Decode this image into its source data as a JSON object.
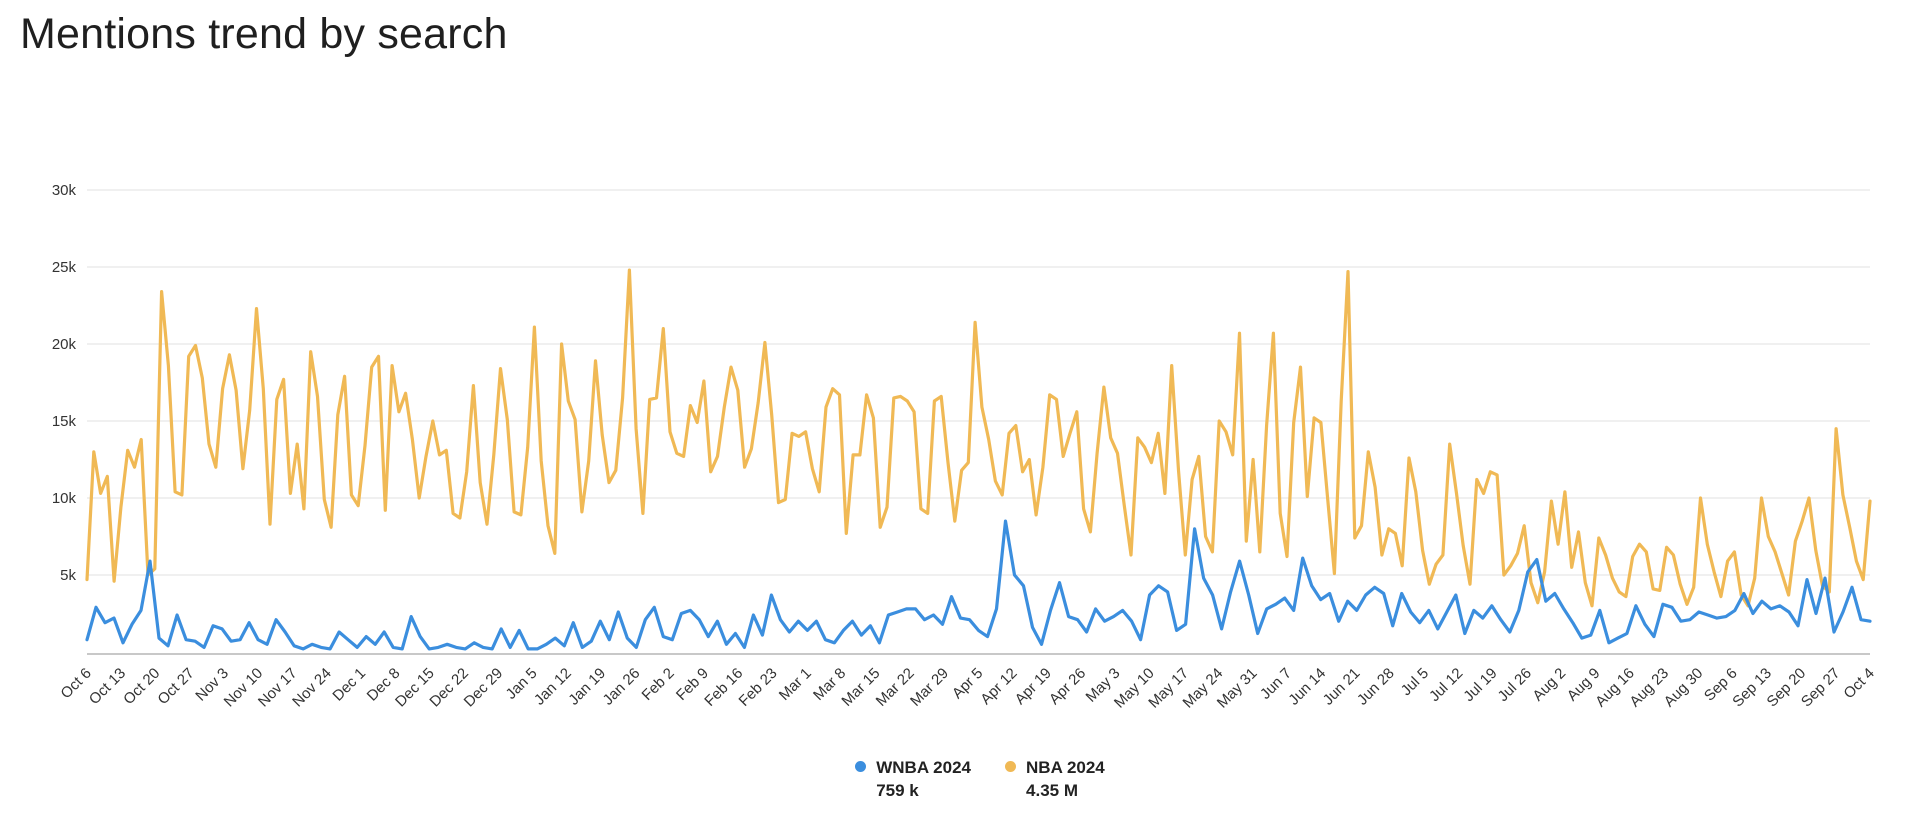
{
  "title": "Mentions trend by search",
  "legend": [
    {
      "name": "WNBA 2024",
      "total": "759 k",
      "color": "#3b8ede"
    },
    {
      "name": "NBA 2024",
      "total": "4.35 M",
      "color": "#f0b955"
    }
  ],
  "chart_data": {
    "type": "line",
    "title": "Mentions trend by search",
    "xlabel": "",
    "ylabel": "",
    "ylim": [
      0,
      30000
    ],
    "yticks": [
      5000,
      10000,
      15000,
      20000,
      25000,
      30000
    ],
    "ytick_labels": [
      "5k",
      "10k",
      "15k",
      "20k",
      "25k",
      "30k"
    ],
    "grid": true,
    "legend_position": "bottom-center",
    "x_unit": "day offset from Oct 6 (sampled every 2 days)",
    "x_range_days": [
      0,
      364
    ],
    "xtick_labels": [
      "Oct 6",
      "Oct 13",
      "Oct 20",
      "Oct 27",
      "Nov 3",
      "Nov 10",
      "Nov 17",
      "Nov 24",
      "Dec 1",
      "Dec 8",
      "Dec 15",
      "Dec 22",
      "Dec 29",
      "Jan 5",
      "Jan 12",
      "Jan 19",
      "Jan 26",
      "Feb 2",
      "Feb 9",
      "Feb 16",
      "Feb 23",
      "Mar 1",
      "Mar 8",
      "Mar 15",
      "Mar 22",
      "Mar 29",
      "Apr 5",
      "Apr 12",
      "Apr 19",
      "Apr 26",
      "May 3",
      "May 10",
      "May 17",
      "May 24",
      "May 31",
      "Jun 7",
      "Jun 14",
      "Jun 21",
      "Jun 28",
      "Jul 5",
      "Jul 12",
      "Jul 19",
      "Jul 26",
      "Aug 2",
      "Aug 9",
      "Aug 16",
      "Aug 23",
      "Aug 30",
      "Sep 6",
      "Sep 13",
      "Sep 20",
      "Sep 27",
      "Oct 4"
    ],
    "xtick_step_days": 7,
    "series": [
      {
        "name": "WNBA 2024",
        "color": "#3b8ede",
        "total": "759 k",
        "values": [
          800,
          2900,
          1900,
          2200,
          600,
          1800,
          2700,
          5900,
          900,
          400,
          2400,
          800,
          700,
          300,
          1700,
          1500,
          700,
          800,
          1900,
          800,
          500,
          2100,
          1300,
          400,
          200,
          500,
          300,
          200,
          1300,
          800,
          300,
          1000,
          500,
          1300,
          300,
          200,
          2300,
          1000,
          200,
          300,
          500,
          300,
          200,
          600,
          300,
          200,
          1500,
          300,
          1400,
          200,
          200,
          500,
          900,
          400,
          1900,
          300,
          700,
          2000,
          800,
          2600,
          900,
          300,
          2100,
          2900,
          1000,
          800,
          2500,
          2700,
          2100,
          1000,
          2000,
          500,
          1200,
          300,
          2400,
          1100,
          3700,
          2100,
          1300,
          2000,
          1400,
          2000,
          800,
          600,
          1400,
          2000,
          1100,
          1700,
          600,
          2400,
          2600,
          2800,
          2800,
          2100,
          2400,
          1800,
          3600,
          2200,
          2100,
          1400,
          1000,
          2800,
          8500,
          5000,
          4300,
          1600,
          500,
          2700,
          4500,
          2300,
          2100,
          1300,
          2800,
          2000,
          2300,
          2700,
          2000,
          800,
          3700,
          4300,
          3900,
          1400,
          1800,
          8000,
          4800,
          3700,
          1500,
          3900,
          5900,
          3700,
          1200,
          2800,
          3100,
          3500,
          2700,
          6100,
          4300,
          3400,
          3800,
          2000,
          3300,
          2700,
          3700,
          4200,
          3800,
          1700,
          3800,
          2600,
          1900,
          2700,
          1500,
          2600,
          3700,
          1200,
          2700,
          2200,
          3000,
          2100,
          1300,
          2700,
          5200,
          6000,
          3300,
          3800,
          2800,
          1900,
          900,
          1100,
          2700,
          600,
          900,
          1200,
          3000,
          1800,
          1000,
          3100,
          2900,
          2000,
          2100,
          2600,
          2400,
          2200,
          2300,
          2700,
          3800,
          2500,
          3300,
          2800,
          3000,
          2600,
          1700,
          4700,
          2500,
          4800,
          1300,
          2600,
          4200,
          2100,
          2000
        ]
      },
      {
        "name": "NBA 2024",
        "color": "#f0b955",
        "total": "4.35 M",
        "values": [
          4700,
          13000,
          10300,
          11400,
          4600,
          9400,
          13100,
          12000,
          13800,
          5000,
          5400,
          23400,
          18600,
          10400,
          10200,
          19200,
          19900,
          17800,
          13500,
          12000,
          17100,
          19300,
          17000,
          11900,
          15700,
          22300,
          17100,
          8300,
          16400,
          17700,
          10300,
          13500,
          9300,
          19500,
          16600,
          9900,
          8100,
          15400,
          17900,
          10200,
          9500,
          13400,
          18500,
          19200,
          9200,
          18600,
          15600,
          16800,
          13800,
          10000,
          12700,
          15000,
          12800,
          13100,
          9000,
          8700,
          11700,
          17300,
          11000,
          8300,
          12800,
          18400,
          15100,
          9100,
          8900,
          13300,
          21100,
          12400,
          8200,
          6400,
          20000,
          16300,
          15100,
          9100,
          12400,
          18900,
          14100,
          11000,
          11800,
          16500,
          24800,
          14500,
          9000,
          16400,
          16500,
          21000,
          14300,
          12900,
          12700,
          16000,
          14900,
          17600,
          11700,
          12700,
          15900,
          18500,
          17000,
          12000,
          13200,
          16200,
          20100,
          15400,
          9700,
          9900,
          14200,
          14000,
          14300,
          11900,
          10400,
          15900,
          17100,
          16700,
          7700,
          12800,
          12800,
          16700,
          15200,
          8100,
          9400,
          16500,
          16600,
          16300,
          15600,
          9300,
          9000,
          16300,
          16600,
          12300,
          8500,
          11800,
          12300,
          21400,
          15900,
          13800,
          11100,
          10200,
          14200,
          14700,
          11700,
          12500,
          8900,
          12000,
          16700,
          16400,
          12700,
          14200,
          15600,
          9300,
          7800,
          12900,
          17200,
          13900,
          12900,
          9500,
          6300,
          13900,
          13300,
          12300,
          14200,
          10300,
          18600,
          11800,
          6300,
          11200,
          12700,
          7500,
          6500,
          15000,
          14300,
          12800,
          20700,
          7200,
          12500,
          6500,
          14700,
          20700,
          9000,
          6200,
          14900,
          18500,
          10100,
          15200,
          14900,
          10000,
          5100,
          16300,
          24700,
          7400,
          8200,
          13000,
          10700,
          6300,
          8000,
          7700,
          5600,
          12600,
          10400,
          6600,
          4400,
          5700,
          6300,
          13500,
          10300,
          6900,
          4400,
          11200,
          10300,
          11700,
          11500,
          5000,
          5600,
          6400,
          8200,
          4500,
          3200,
          5200,
          9800,
          7000,
          10400,
          5500,
          7800,
          4500,
          3000,
          7400,
          6300,
          4800,
          3900,
          3600,
          6200,
          7000,
          6500,
          4100,
          4000,
          6800,
          6300,
          4400,
          3100,
          4200,
          10000,
          7000,
          5200,
          3600,
          5900,
          6500,
          3700,
          3000,
          4800,
          10000,
          7500,
          6500,
          5100,
          3700,
          7200,
          8500,
          10000,
          6600,
          4300,
          3900,
          14500,
          10200,
          8100,
          5900,
          4700,
          9800
        ]
      }
    ]
  }
}
